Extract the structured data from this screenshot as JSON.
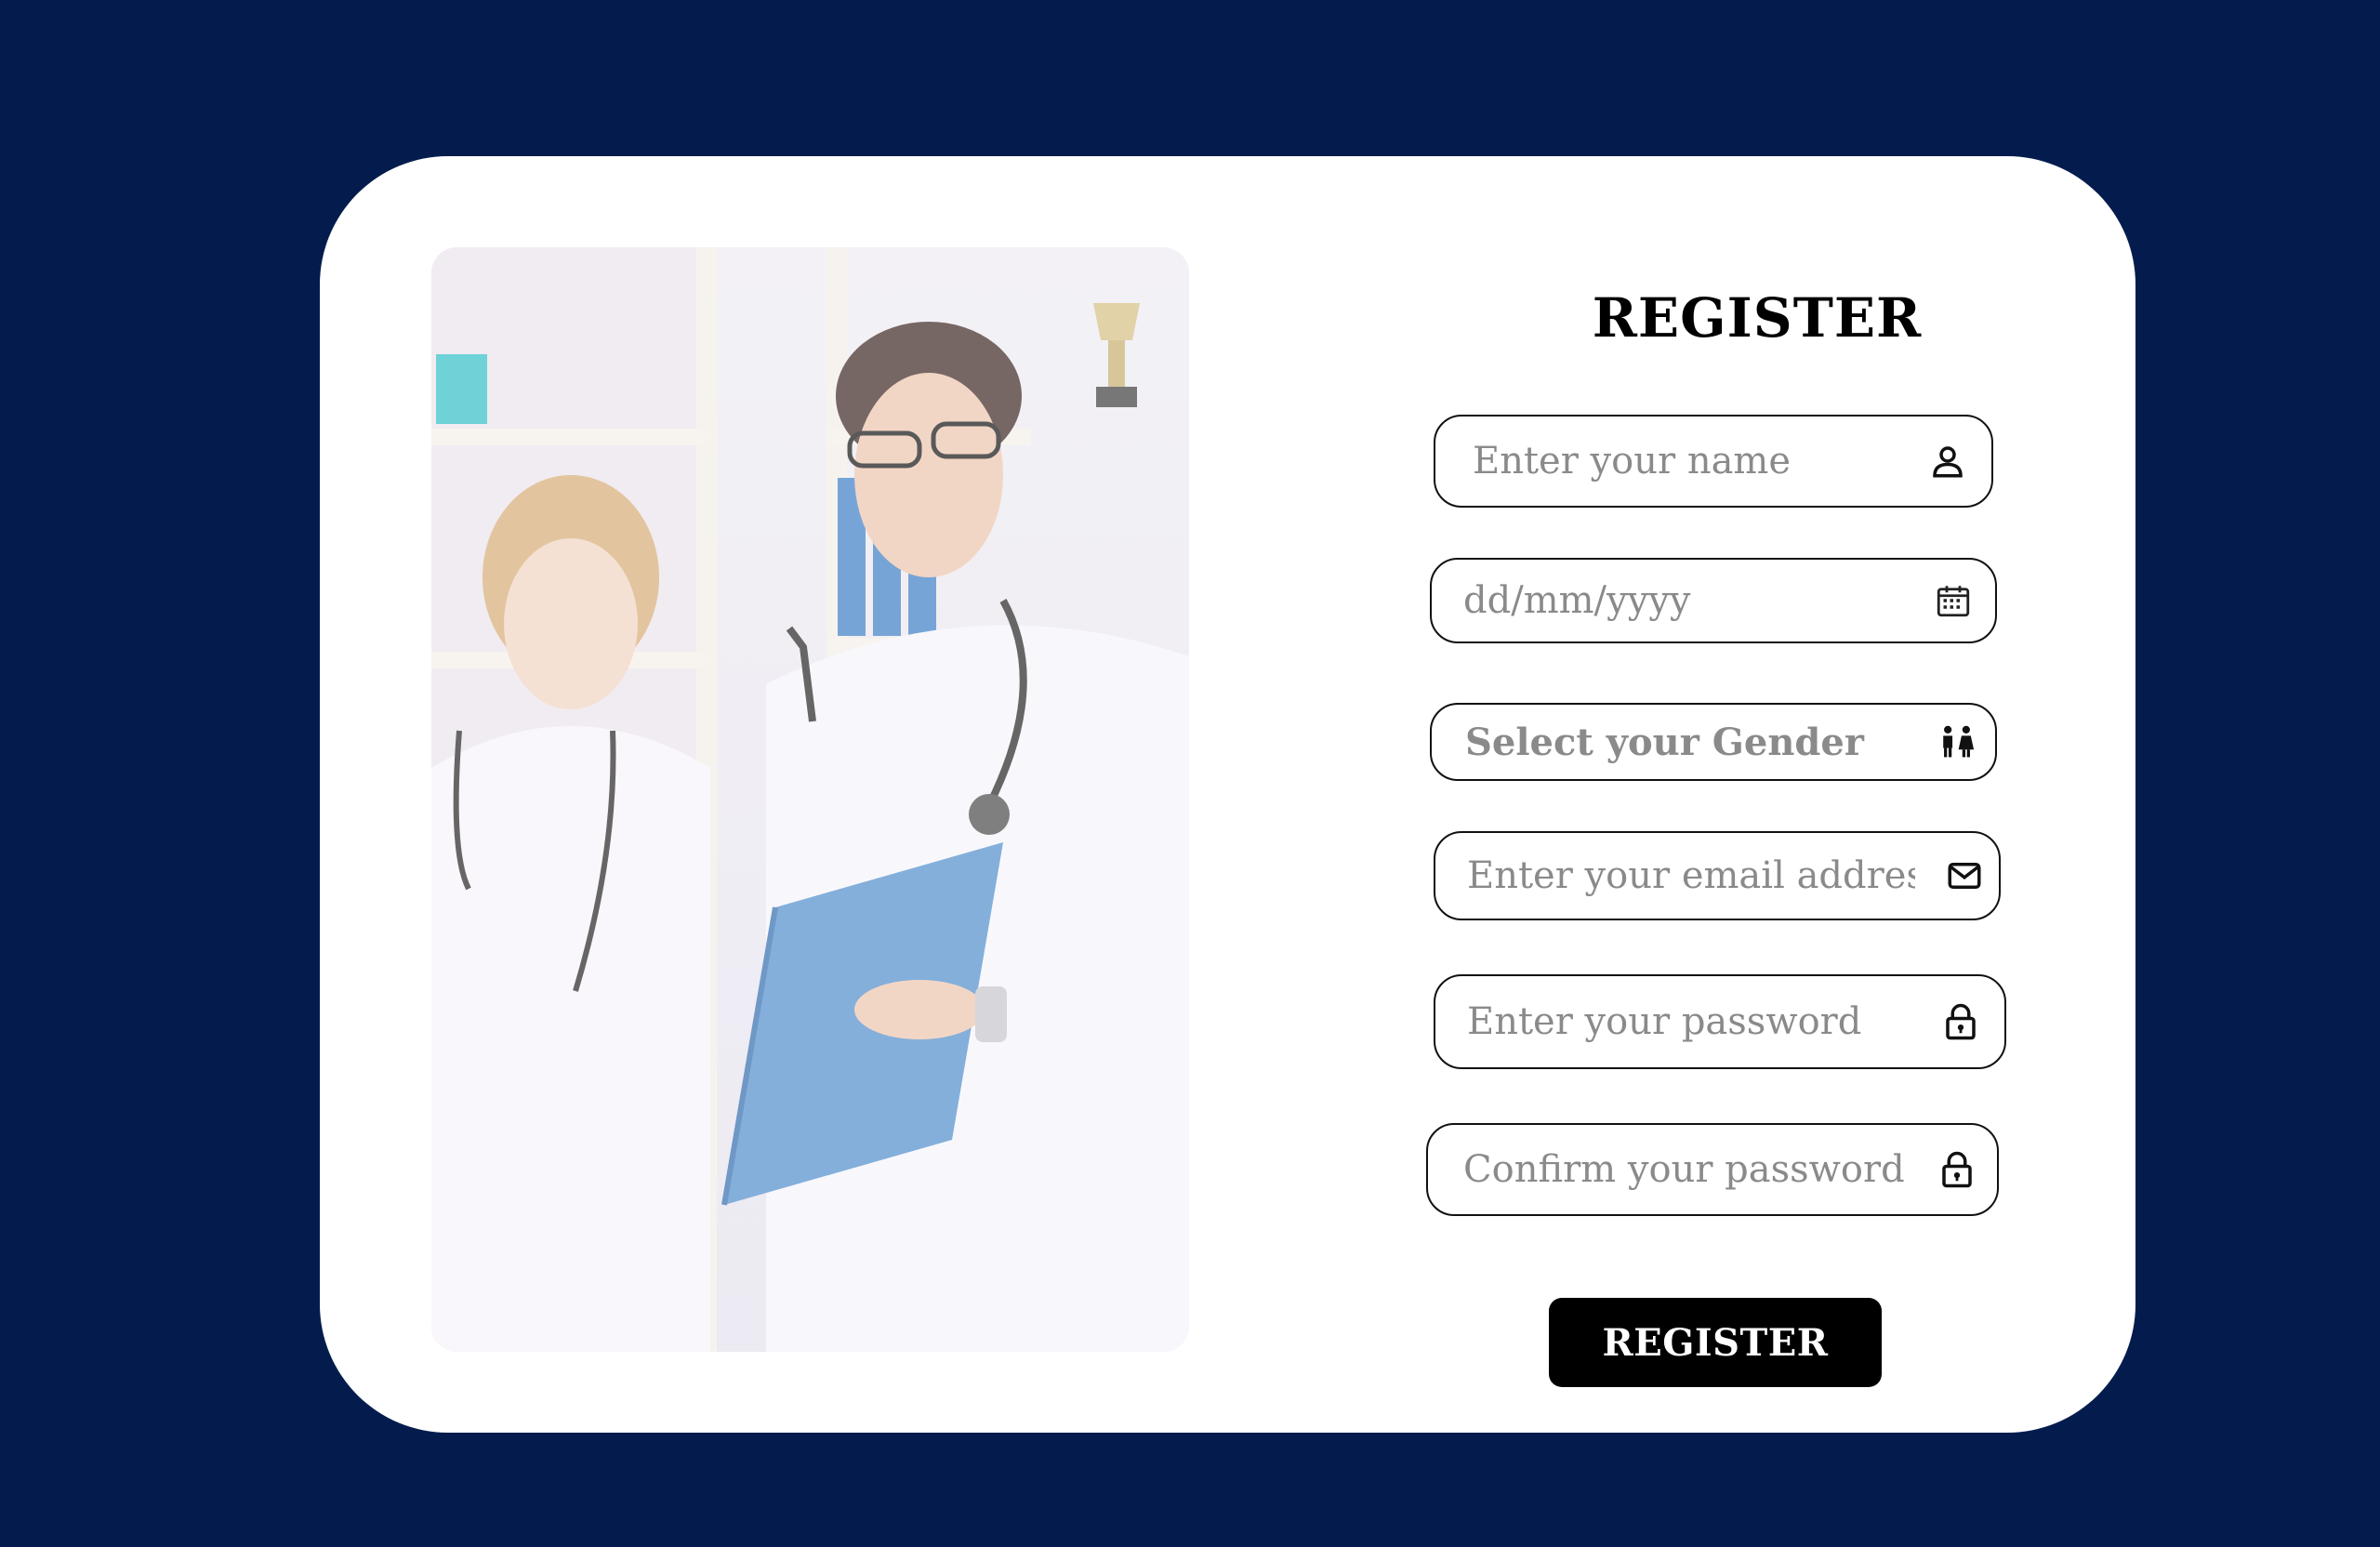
{
  "page": {
    "background_color": "#041c4d",
    "card_color": "#ffffff"
  },
  "hero_image": {
    "description_icon": "doctors-photo"
  },
  "form": {
    "title": "REGISTER",
    "fields": {
      "name": {
        "placeholder": "Enter your name",
        "icon": "user-icon"
      },
      "dob": {
        "placeholder": "dd/mm/yyyy",
        "icon": "calendar-icon"
      },
      "gender": {
        "label": "Select your Gender",
        "icon": "gender-icon"
      },
      "email": {
        "placeholder": "Enter your email address",
        "icon": "mail-icon"
      },
      "password": {
        "placeholder": "Enter your password",
        "icon": "lock-icon"
      },
      "confirm_password": {
        "placeholder": "Confirm your password",
        "icon": "lock-icon"
      }
    },
    "submit_label": "REGISTER"
  }
}
